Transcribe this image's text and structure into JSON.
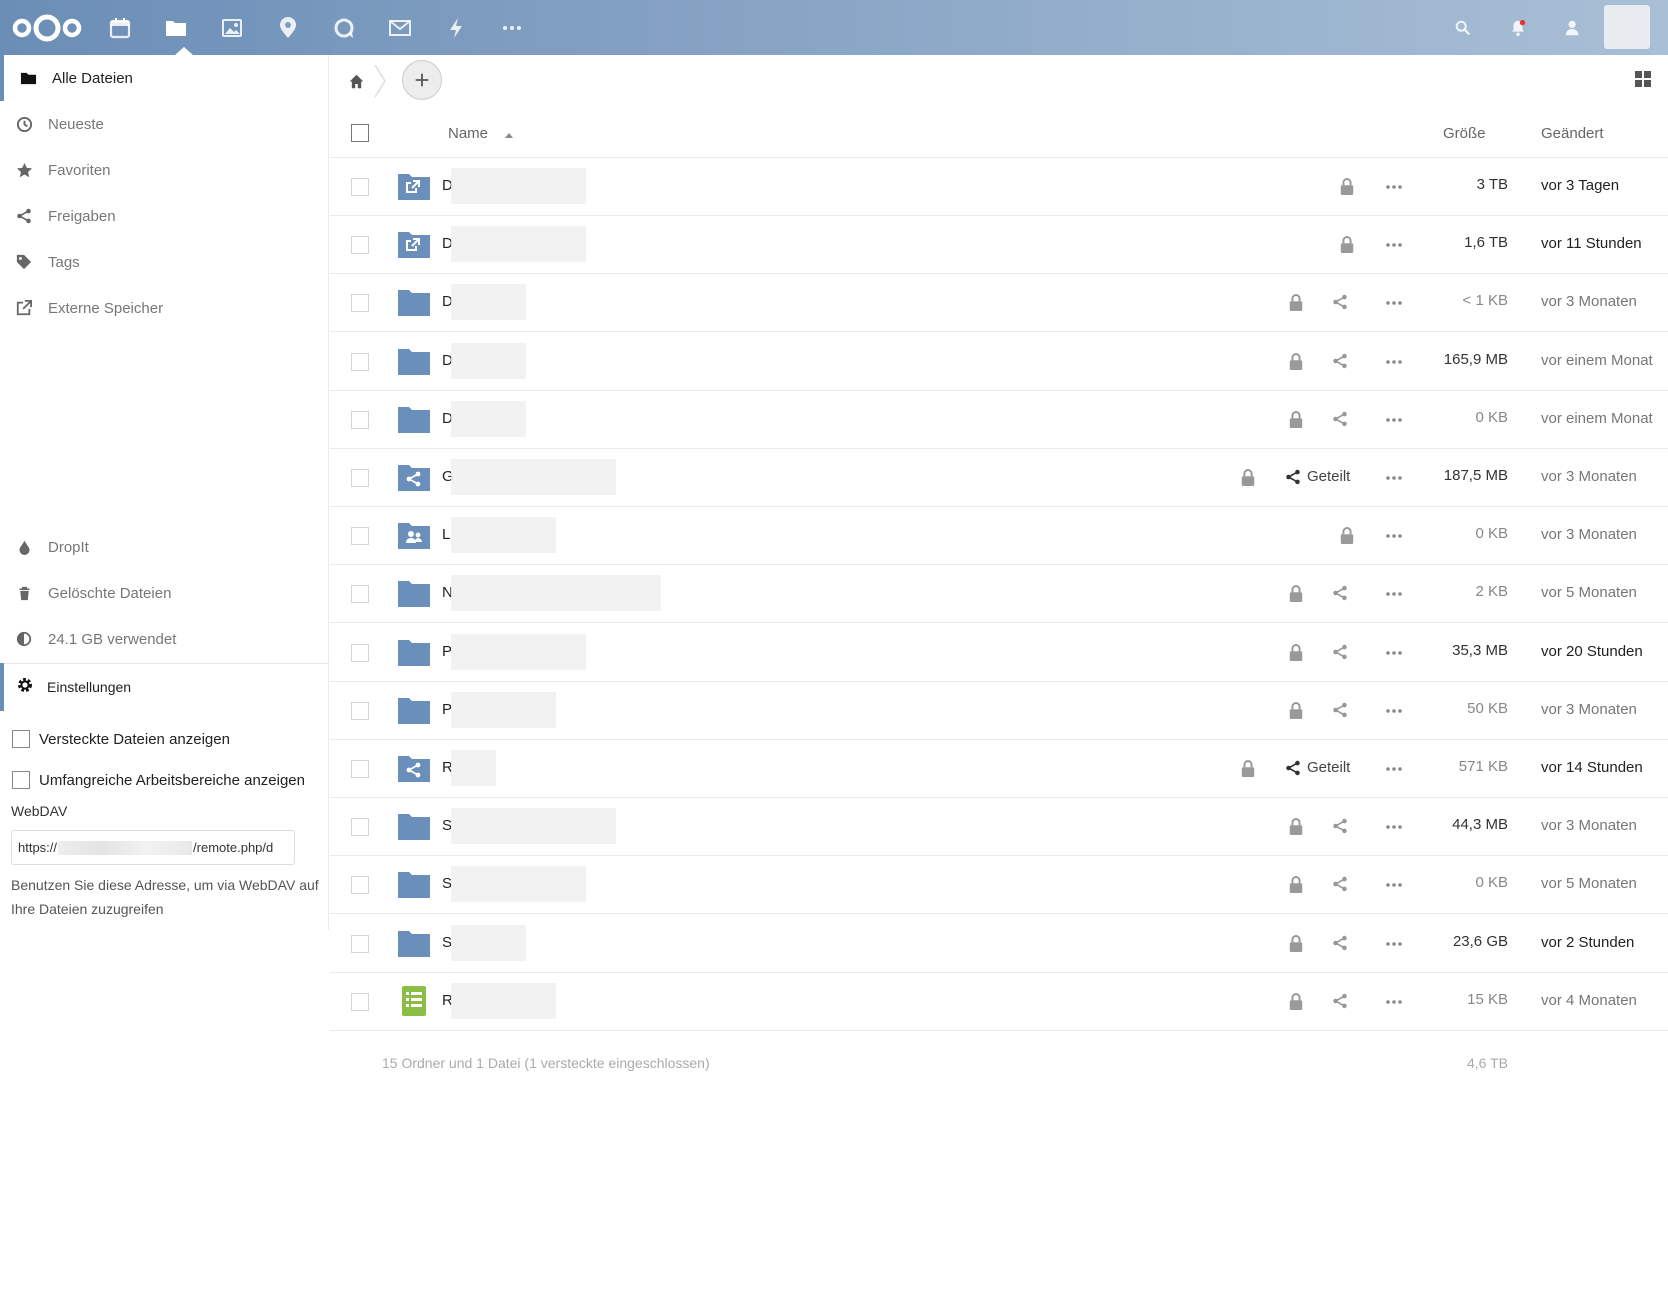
{
  "header": {
    "apps": [
      {
        "name": "calendar-icon"
      },
      {
        "name": "files-icon",
        "active": true
      },
      {
        "name": "photos-icon"
      },
      {
        "name": "maps-icon"
      },
      {
        "name": "talk-icon"
      },
      {
        "name": "mail-icon"
      },
      {
        "name": "activity-icon"
      },
      {
        "name": "more-apps-icon"
      }
    ],
    "notification_dot_color": "#e9322d"
  },
  "sidebar": {
    "items": [
      {
        "label": "Alle Dateien",
        "icon": "folder-icon",
        "active": true
      },
      {
        "label": "Neueste",
        "icon": "clock-icon"
      },
      {
        "label": "Favoriten",
        "icon": "star-icon"
      },
      {
        "label": "Freigaben",
        "icon": "share-icon"
      },
      {
        "label": "Tags",
        "icon": "tag-icon"
      },
      {
        "label": "Externe Speicher",
        "icon": "external-icon"
      }
    ],
    "bottom_items": [
      {
        "label": "DropIt",
        "icon": "drop-icon"
      },
      {
        "label": "Gelöschte Dateien",
        "icon": "trash-icon"
      },
      {
        "label": "24.1 GB verwendet",
        "icon": "quota-icon"
      }
    ],
    "settings_label": "Einstellungen",
    "show_hidden_label": "Versteckte Dateien anzeigen",
    "rich_workspaces_label": "Umfangreiche Arbeitsbereiche anzeigen",
    "webdav_label": "WebDAV",
    "webdav_prefix": "https://",
    "webdav_suffix": "/remote.php/d",
    "webdav_help": "Benutzen Sie diese Adresse, um via WebDAV auf Ihre Dateien zuzugreifen"
  },
  "files": {
    "columns": {
      "name": "Name",
      "size": "Größe",
      "modified": "Geändert"
    },
    "shared_label": "Geteilt",
    "rows": [
      {
        "initial": "D",
        "type": "external",
        "share": "none",
        "size": "3 TB",
        "modified": "vor 3 Tagen"
      },
      {
        "initial": "D",
        "type": "external",
        "share": "none",
        "size": "1,6 TB",
        "modified": "vor 11 Stunden"
      },
      {
        "initial": "D",
        "type": "folder",
        "share": "icon",
        "size": "< 1 KB",
        "modified": "vor 3 Monaten"
      },
      {
        "initial": "D",
        "type": "folder",
        "share": "icon",
        "size": "165,9 MB",
        "modified": "vor einem Monat"
      },
      {
        "initial": "D",
        "type": "folder",
        "share": "icon",
        "size": "0 KB",
        "modified": "vor einem Monat"
      },
      {
        "initial": "G",
        "type": "shared",
        "share": "label",
        "size": "187,5 MB",
        "modified": "vor 3 Monaten"
      },
      {
        "initial": "L",
        "type": "group",
        "share": "none",
        "size": "0 KB",
        "modified": "vor 3 Monaten"
      },
      {
        "initial": "N",
        "type": "folder",
        "share": "icon",
        "size": "2 KB",
        "modified": "vor 5 Monaten"
      },
      {
        "initial": "P",
        "type": "folder",
        "share": "icon",
        "size": "35,3 MB",
        "modified": "vor 20 Stunden"
      },
      {
        "initial": "P",
        "type": "folder",
        "share": "icon",
        "size": "50 KB",
        "modified": "vor 3 Monaten"
      },
      {
        "initial": "R",
        "type": "shared",
        "share": "label",
        "size": "571 KB",
        "modified": "vor 14 Stunden"
      },
      {
        "initial": "S",
        "type": "folder",
        "share": "icon",
        "size": "44,3 MB",
        "modified": "vor 3 Monaten"
      },
      {
        "initial": "S",
        "type": "folder",
        "share": "icon",
        "size": "0 KB",
        "modified": "vor 5 Monaten"
      },
      {
        "initial": "S",
        "type": "folder",
        "share": "icon",
        "size": "23,6 GB",
        "modified": "vor 2 Stunden"
      },
      {
        "initial": "R",
        "type": "spreadsheet",
        "share": "icon",
        "size": "15 KB",
        "modified": "vor 4 Monaten"
      }
    ],
    "summary": "15 Ordner und 1 Datei (1 versteckte eingeschlossen)",
    "summary_size": "4,6 TB"
  },
  "colors": {
    "accent": "#6b8eb6",
    "folder": "#6a8fbb",
    "spreadsheet": "#8cbd45"
  }
}
